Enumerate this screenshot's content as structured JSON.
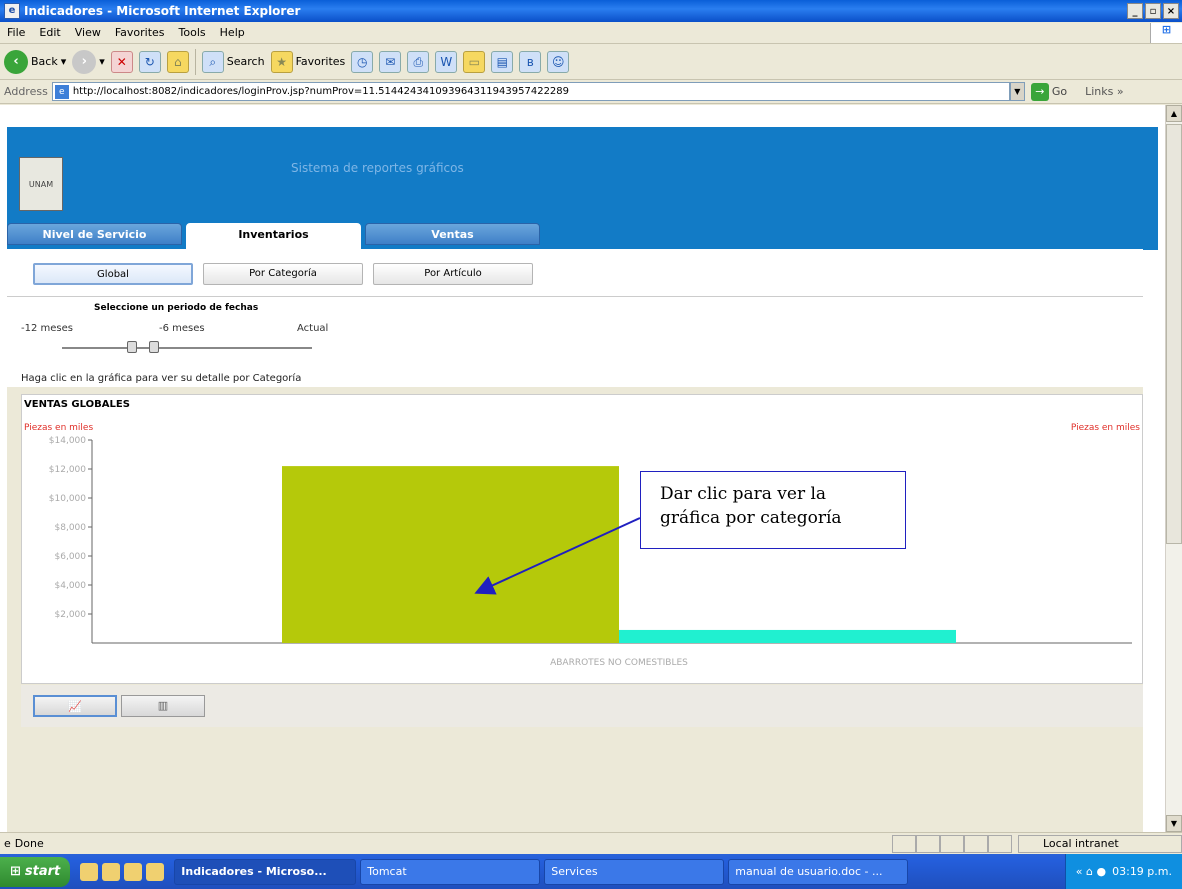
{
  "window": {
    "title": "Indicadores - Microsoft Internet Explorer"
  },
  "menu": [
    "File",
    "Edit",
    "View",
    "Favorites",
    "Tools",
    "Help"
  ],
  "toolbar": {
    "back": "Back",
    "search": "Search",
    "favorites": "Favorites"
  },
  "address": {
    "label": "Address",
    "url": "http://localhost:8082/indicadores/loginProv.jsp?numProv=11.514424341093964311943957422289",
    "go": "Go",
    "links": "Links"
  },
  "page": {
    "system_title": "Sistema de reportes gráficos",
    "tabs": [
      "Nivel de Servicio",
      "Inventarios",
      "Ventas"
    ],
    "subtabs": [
      "Global",
      "Por Categoría",
      "Por Artículo"
    ],
    "period": {
      "title": "Seleccione un periodo de fechas",
      "labels": [
        "-12 meses",
        "-6 meses",
        "Actual"
      ]
    },
    "hint": "Haga clic en la gráfica para ver su detalle por Categoría",
    "chart_title": "VENTAS GLOBALES",
    "callout": [
      "Dar clic para ver la",
      "gráfica por categoría"
    ]
  },
  "chart_data": {
    "type": "bar",
    "title": "VENTAS GLOBALES",
    "ylabel_left": "Piezas en miles",
    "ylabel_right": "Piezas en miles",
    "xlabel": "ABARROTES NO COMESTIBLES",
    "yticks": [
      "$2,000",
      "$4,000",
      "$6,000",
      "$8,000",
      "$10,000",
      "$12,000",
      "$14,000"
    ],
    "ylim": [
      0,
      14000
    ],
    "series": [
      {
        "values": [
          12200
        ],
        "color": "#b5c90a"
      },
      {
        "values": [
          900
        ],
        "color": "#20f0d0"
      }
    ],
    "grid": false
  },
  "status": {
    "text": "Done",
    "zone": "Local intranet"
  },
  "taskbar": {
    "start": "start",
    "tasks": [
      "Indicadores - Microso...",
      "Tomcat",
      "Services",
      "manual de usuario.doc - ..."
    ],
    "time": "03:19 p.m."
  },
  "colors": {
    "header_blue": "#127bc6",
    "bar1": "#b5c90a",
    "bar2": "#20f0d0",
    "axis_label_red": "#e0302a"
  }
}
